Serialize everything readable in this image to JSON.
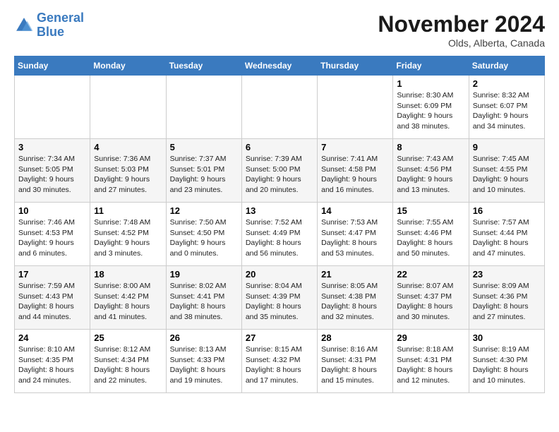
{
  "header": {
    "logo_line1": "General",
    "logo_line2": "Blue",
    "month_title": "November 2024",
    "location": "Olds, Alberta, Canada"
  },
  "weekdays": [
    "Sunday",
    "Monday",
    "Tuesday",
    "Wednesday",
    "Thursday",
    "Friday",
    "Saturday"
  ],
  "weeks": [
    [
      {
        "day": "",
        "info": ""
      },
      {
        "day": "",
        "info": ""
      },
      {
        "day": "",
        "info": ""
      },
      {
        "day": "",
        "info": ""
      },
      {
        "day": "",
        "info": ""
      },
      {
        "day": "1",
        "info": "Sunrise: 8:30 AM\nSunset: 6:09 PM\nDaylight: 9 hours\nand 38 minutes."
      },
      {
        "day": "2",
        "info": "Sunrise: 8:32 AM\nSunset: 6:07 PM\nDaylight: 9 hours\nand 34 minutes."
      }
    ],
    [
      {
        "day": "3",
        "info": "Sunrise: 7:34 AM\nSunset: 5:05 PM\nDaylight: 9 hours\nand 30 minutes."
      },
      {
        "day": "4",
        "info": "Sunrise: 7:36 AM\nSunset: 5:03 PM\nDaylight: 9 hours\nand 27 minutes."
      },
      {
        "day": "5",
        "info": "Sunrise: 7:37 AM\nSunset: 5:01 PM\nDaylight: 9 hours\nand 23 minutes."
      },
      {
        "day": "6",
        "info": "Sunrise: 7:39 AM\nSunset: 5:00 PM\nDaylight: 9 hours\nand 20 minutes."
      },
      {
        "day": "7",
        "info": "Sunrise: 7:41 AM\nSunset: 4:58 PM\nDaylight: 9 hours\nand 16 minutes."
      },
      {
        "day": "8",
        "info": "Sunrise: 7:43 AM\nSunset: 4:56 PM\nDaylight: 9 hours\nand 13 minutes."
      },
      {
        "day": "9",
        "info": "Sunrise: 7:45 AM\nSunset: 4:55 PM\nDaylight: 9 hours\nand 10 minutes."
      }
    ],
    [
      {
        "day": "10",
        "info": "Sunrise: 7:46 AM\nSunset: 4:53 PM\nDaylight: 9 hours\nand 6 minutes."
      },
      {
        "day": "11",
        "info": "Sunrise: 7:48 AM\nSunset: 4:52 PM\nDaylight: 9 hours\nand 3 minutes."
      },
      {
        "day": "12",
        "info": "Sunrise: 7:50 AM\nSunset: 4:50 PM\nDaylight: 9 hours\nand 0 minutes."
      },
      {
        "day": "13",
        "info": "Sunrise: 7:52 AM\nSunset: 4:49 PM\nDaylight: 8 hours\nand 56 minutes."
      },
      {
        "day": "14",
        "info": "Sunrise: 7:53 AM\nSunset: 4:47 PM\nDaylight: 8 hours\nand 53 minutes."
      },
      {
        "day": "15",
        "info": "Sunrise: 7:55 AM\nSunset: 4:46 PM\nDaylight: 8 hours\nand 50 minutes."
      },
      {
        "day": "16",
        "info": "Sunrise: 7:57 AM\nSunset: 4:44 PM\nDaylight: 8 hours\nand 47 minutes."
      }
    ],
    [
      {
        "day": "17",
        "info": "Sunrise: 7:59 AM\nSunset: 4:43 PM\nDaylight: 8 hours\nand 44 minutes."
      },
      {
        "day": "18",
        "info": "Sunrise: 8:00 AM\nSunset: 4:42 PM\nDaylight: 8 hours\nand 41 minutes."
      },
      {
        "day": "19",
        "info": "Sunrise: 8:02 AM\nSunset: 4:41 PM\nDaylight: 8 hours\nand 38 minutes."
      },
      {
        "day": "20",
        "info": "Sunrise: 8:04 AM\nSunset: 4:39 PM\nDaylight: 8 hours\nand 35 minutes."
      },
      {
        "day": "21",
        "info": "Sunrise: 8:05 AM\nSunset: 4:38 PM\nDaylight: 8 hours\nand 32 minutes."
      },
      {
        "day": "22",
        "info": "Sunrise: 8:07 AM\nSunset: 4:37 PM\nDaylight: 8 hours\nand 30 minutes."
      },
      {
        "day": "23",
        "info": "Sunrise: 8:09 AM\nSunset: 4:36 PM\nDaylight: 8 hours\nand 27 minutes."
      }
    ],
    [
      {
        "day": "24",
        "info": "Sunrise: 8:10 AM\nSunset: 4:35 PM\nDaylight: 8 hours\nand 24 minutes."
      },
      {
        "day": "25",
        "info": "Sunrise: 8:12 AM\nSunset: 4:34 PM\nDaylight: 8 hours\nand 22 minutes."
      },
      {
        "day": "26",
        "info": "Sunrise: 8:13 AM\nSunset: 4:33 PM\nDaylight: 8 hours\nand 19 minutes."
      },
      {
        "day": "27",
        "info": "Sunrise: 8:15 AM\nSunset: 4:32 PM\nDaylight: 8 hours\nand 17 minutes."
      },
      {
        "day": "28",
        "info": "Sunrise: 8:16 AM\nSunset: 4:31 PM\nDaylight: 8 hours\nand 15 minutes."
      },
      {
        "day": "29",
        "info": "Sunrise: 8:18 AM\nSunset: 4:31 PM\nDaylight: 8 hours\nand 12 minutes."
      },
      {
        "day": "30",
        "info": "Sunrise: 8:19 AM\nSunset: 4:30 PM\nDaylight: 8 hours\nand 10 minutes."
      }
    ]
  ]
}
